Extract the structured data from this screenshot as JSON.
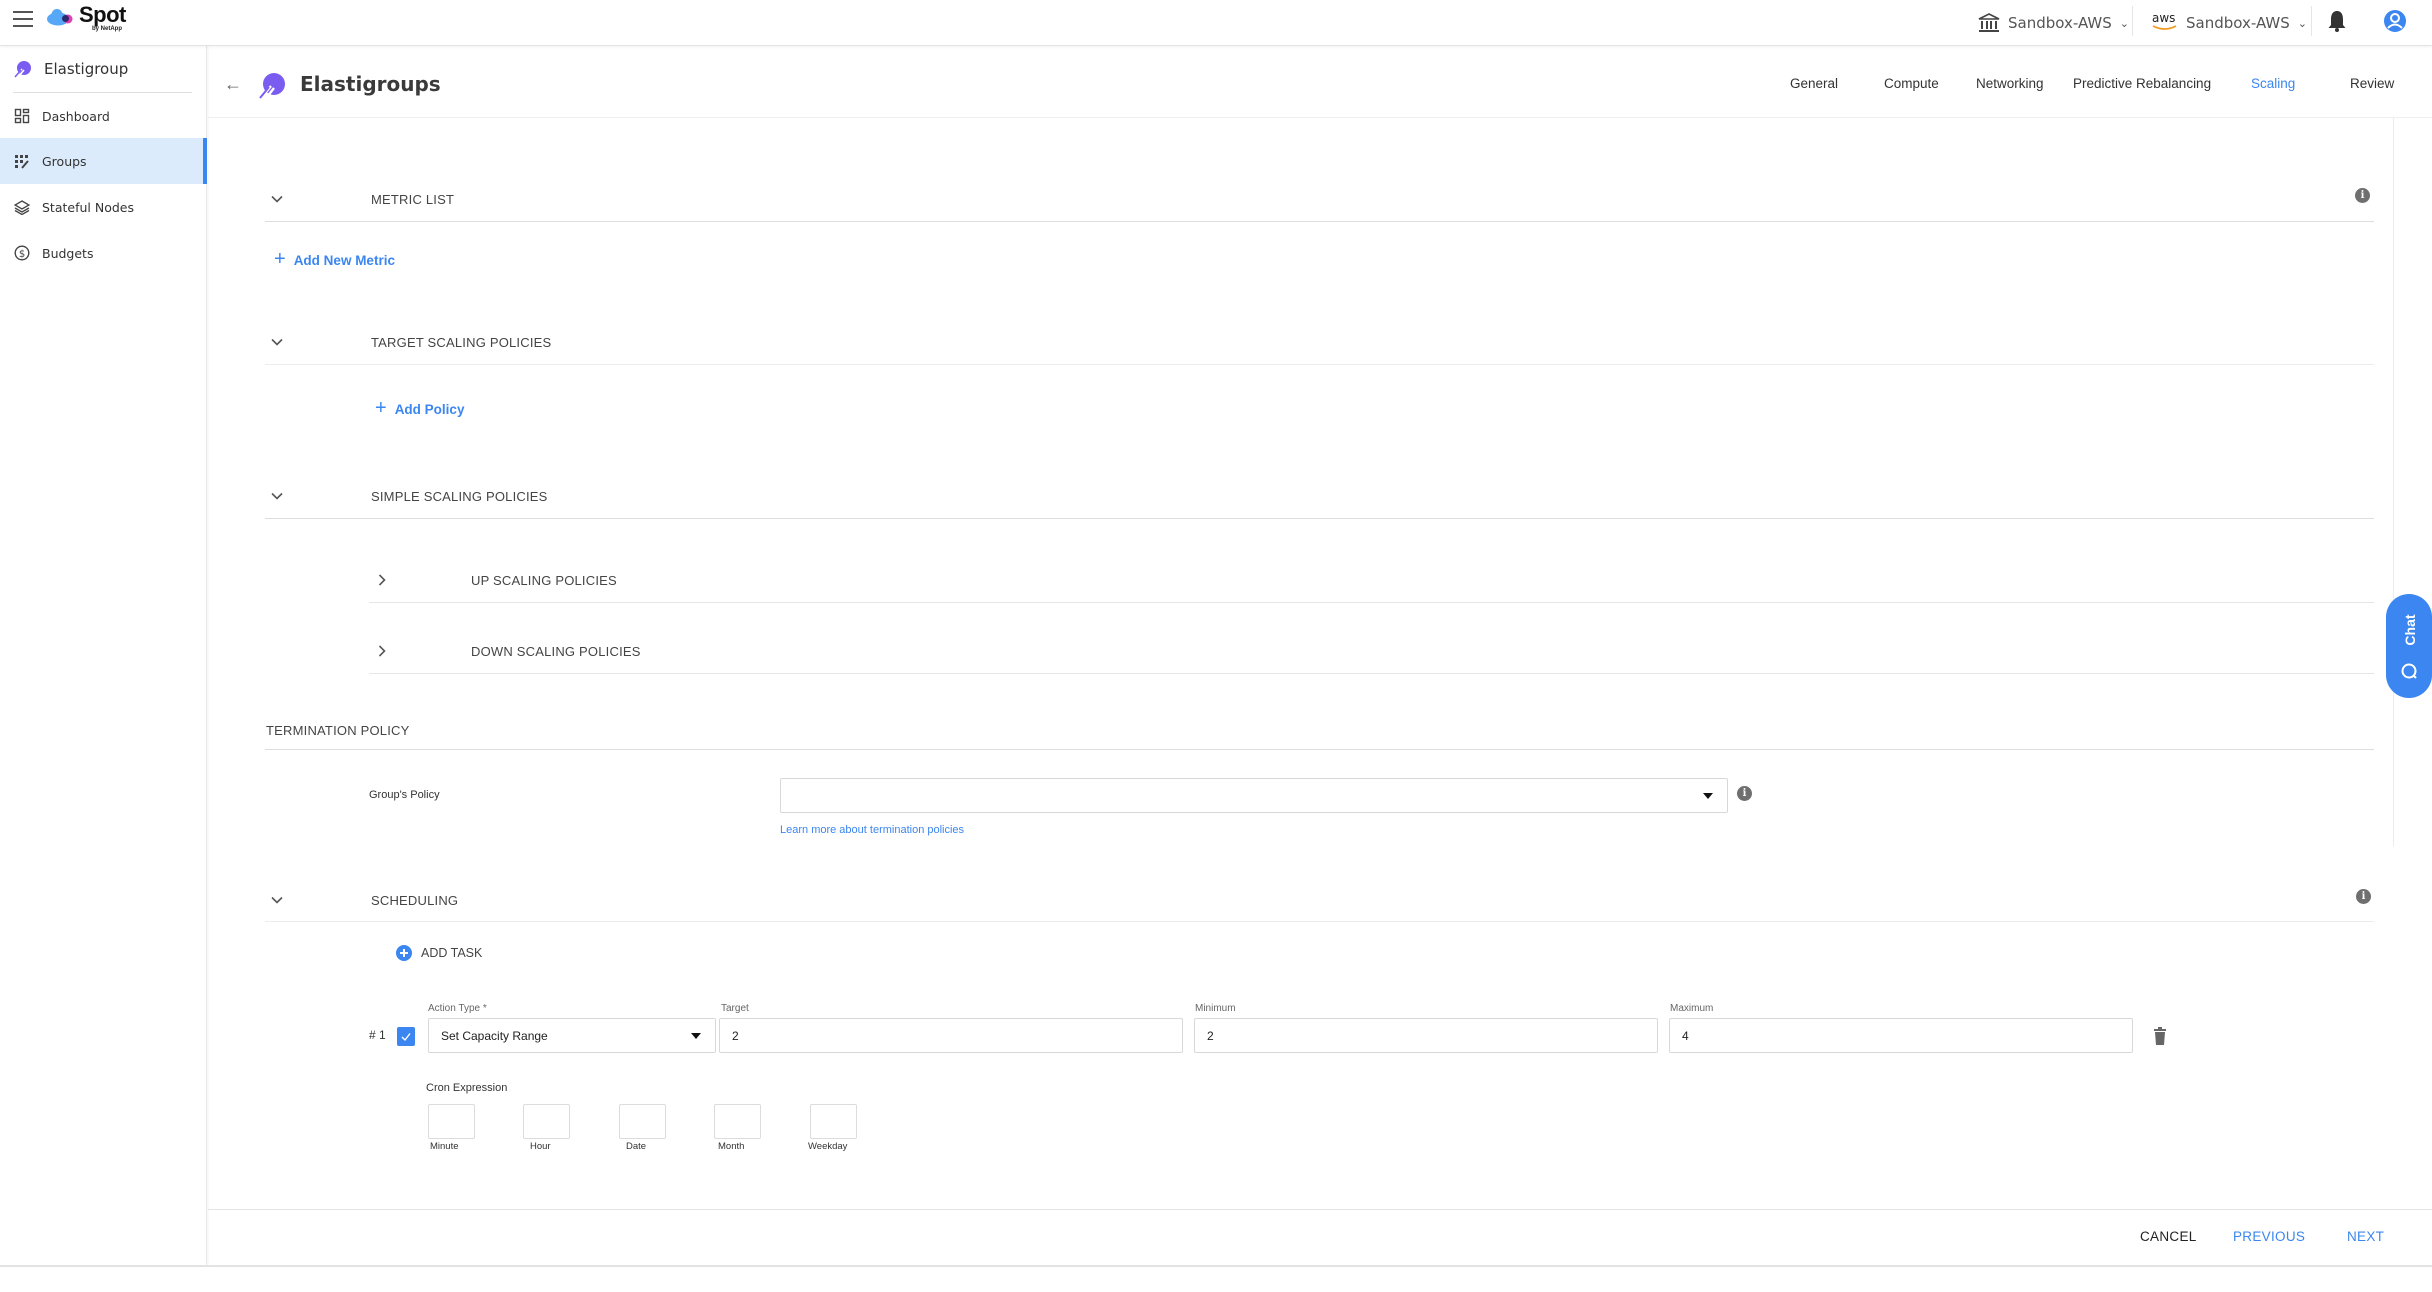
{
  "app": {
    "brand": "Spot",
    "brand_sub": "by NetApp"
  },
  "topbar": {
    "org_selector": {
      "label": "Sandbox-AWS",
      "icon": "bank-icon"
    },
    "account_selector": {
      "label": "Sandbox-AWS",
      "icon": "aws-logo-icon",
      "aws_text": "aws"
    },
    "notifications_icon": "bell-icon",
    "user_icon": "user-avatar-icon"
  },
  "sidebar": {
    "product": "Elastigroup",
    "items": [
      {
        "label": "Dashboard",
        "icon": "dashboard-icon",
        "active": false
      },
      {
        "label": "Groups",
        "icon": "groups-icon",
        "active": true
      },
      {
        "label": "Stateful Nodes",
        "icon": "layers-icon",
        "active": false
      },
      {
        "label": "Budgets",
        "icon": "dollar-circle-icon",
        "active": false
      }
    ]
  },
  "header": {
    "title": "Elastigroups",
    "tabs": [
      {
        "label": "General",
        "active": false
      },
      {
        "label": "Compute",
        "active": false
      },
      {
        "label": "Networking",
        "active": false
      },
      {
        "label": "Predictive Rebalancing",
        "active": false
      },
      {
        "label": "Scaling",
        "active": true
      },
      {
        "label": "Review",
        "active": false
      }
    ]
  },
  "sections": {
    "metric_list": {
      "title": "METRIC LIST",
      "add_label": "Add New Metric"
    },
    "target_scaling": {
      "title": "TARGET SCALING POLICIES",
      "add_label": "Add Policy"
    },
    "simple_scaling": {
      "title": "SIMPLE SCALING POLICIES",
      "up": "UP SCALING POLICIES",
      "down": "DOWN SCALING POLICIES"
    },
    "termination": {
      "title": "TERMINATION POLICY",
      "field_label": "Group's Policy",
      "select_value": "",
      "learn_more": "Learn more about termination policies"
    },
    "scheduling": {
      "title": "SCHEDULING",
      "add_task": "ADD TASK",
      "tasks": [
        {
          "index": "# 1",
          "checked": true,
          "action_type_label": "Action Type *",
          "action_type_value": "Set Capacity Range",
          "target_label": "Target",
          "target_value": "2",
          "minimum_label": "Minimum",
          "minimum_value": "2",
          "maximum_label": "Maximum",
          "maximum_value": "4",
          "cron_label": "Cron Expression",
          "cron_fields": [
            {
              "caption": "Minute",
              "value": ""
            },
            {
              "caption": "Hour",
              "value": ""
            },
            {
              "caption": "Date",
              "value": ""
            },
            {
              "caption": "Month",
              "value": ""
            },
            {
              "caption": "Weekday",
              "value": ""
            }
          ]
        }
      ]
    }
  },
  "footer": {
    "cancel": "CANCEL",
    "previous": "PREVIOUS",
    "next": "NEXT"
  },
  "chat": {
    "label": "Chat"
  },
  "colors": {
    "accent": "#3b86f0",
    "active_bg": "#dcebfb",
    "brand_purple": "#7b5cf0"
  }
}
